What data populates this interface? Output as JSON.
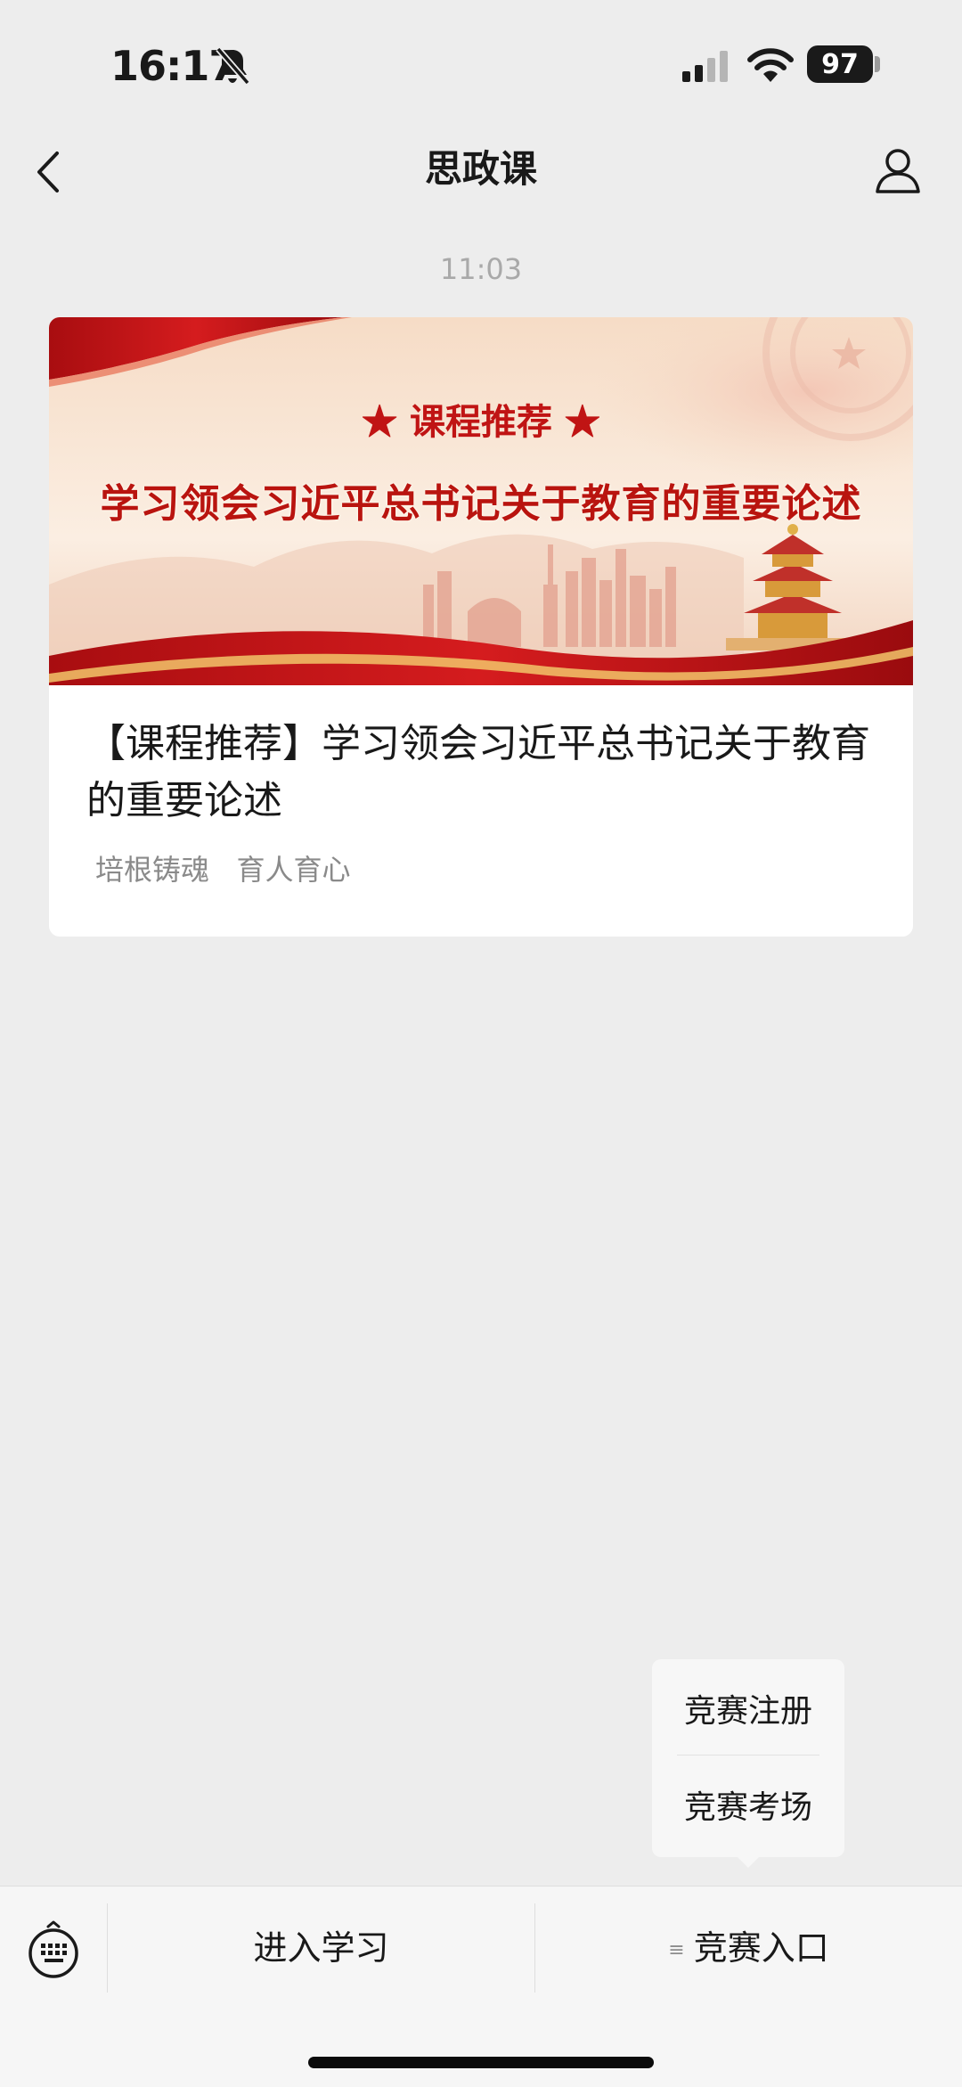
{
  "status_bar": {
    "time": "16:17",
    "battery": "97",
    "icons": [
      "bell-slash-icon",
      "signal-icon",
      "wifi-icon",
      "battery-icon"
    ]
  },
  "nav": {
    "title": "思政课",
    "back_icon": "chevron-left-icon",
    "profile_icon": "person-icon"
  },
  "chat": {
    "timestamp": "11:03",
    "article": {
      "banner_subtitle": "★ 课程推荐 ★",
      "banner_title": "学习领会习近平总书记关于教育的重要论述",
      "title": "【课程推荐】学习领会习近平总书记关于教育的重要论述",
      "description": "培根铸魂   育人育心"
    }
  },
  "popup_menu": {
    "items": [
      "竞赛注册",
      "竞赛考场"
    ]
  },
  "bottom_menu": {
    "keyboard_icon": "keyboard-icon",
    "items": [
      {
        "label": "进入学习"
      },
      {
        "label": "竞赛入口",
        "has_submenu_icon": true
      }
    ]
  },
  "colors": {
    "background": "#ededed",
    "banner_red": "#c8161d",
    "card": "#ffffff",
    "secondary_text": "#8a8a8a"
  }
}
